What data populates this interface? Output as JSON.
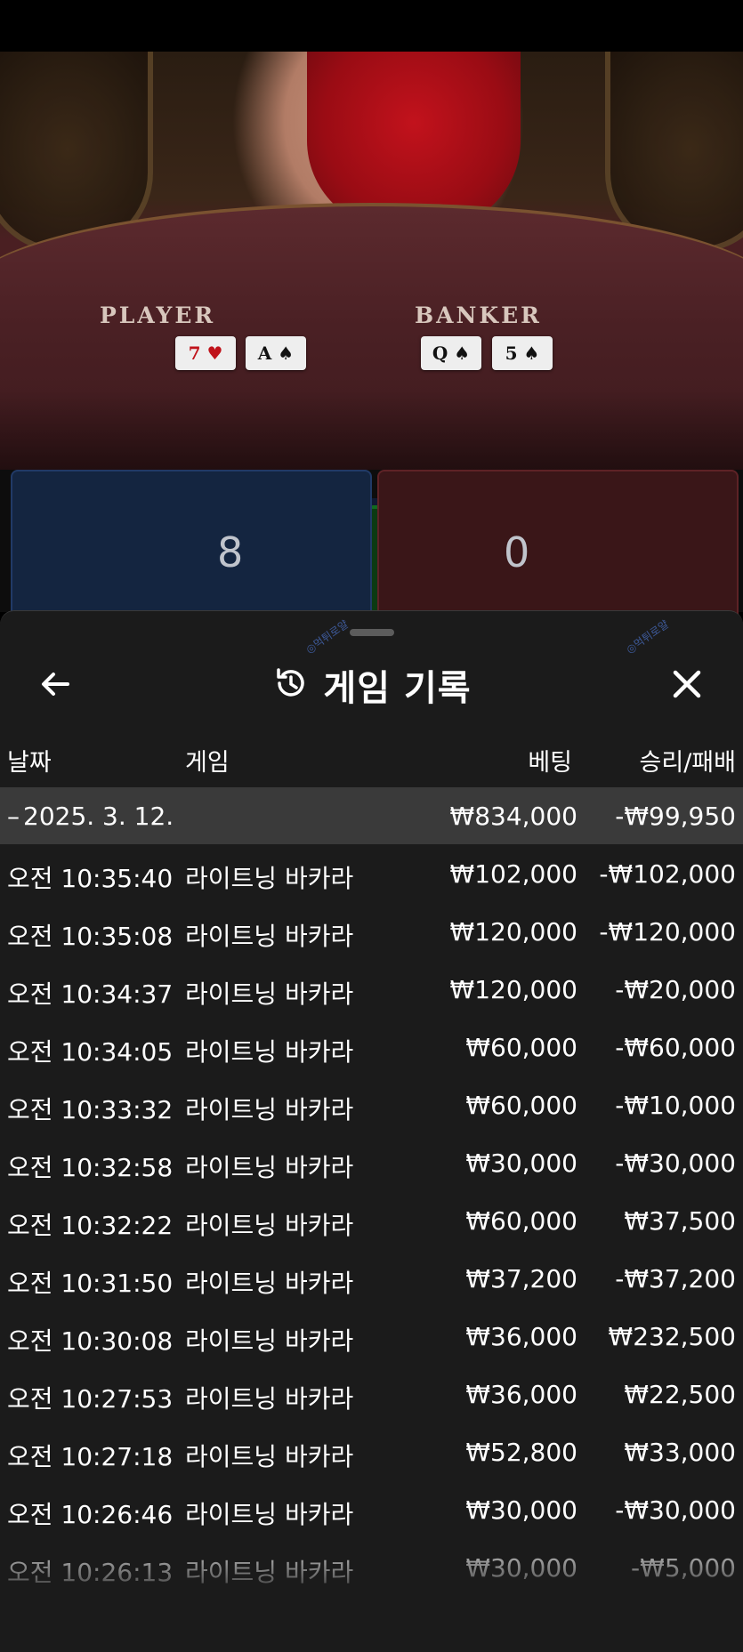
{
  "video": {
    "player_label": "PLAYER",
    "banker_label": "BANKER",
    "player_cards": [
      {
        "rank": "7",
        "suit": "♥",
        "red": true
      },
      {
        "rank": "A",
        "suit": "♠",
        "red": false
      }
    ],
    "banker_cards": [
      {
        "rank": "Q",
        "suit": "♠",
        "red": false
      },
      {
        "rank": "5",
        "suit": "♠",
        "red": false
      }
    ]
  },
  "scoreboard": {
    "player_score": "8",
    "banker_score": "0",
    "player_color": "#142540",
    "banker_color": "#3a1618",
    "tie_color": "#0c3a12"
  },
  "history": {
    "title": "게임 기록",
    "back_icon": "arrow-left-icon",
    "history_icon": "history-clock-icon",
    "close_icon": "close-icon",
    "columns": {
      "date": "날짜",
      "game": "게임",
      "bet": "베팅",
      "result": "승리/패배"
    },
    "date_group": {
      "toggle": "–",
      "date": "2025. 3. 12.",
      "total_bet": "₩834,000",
      "total_result": "-₩99,950"
    },
    "rows": [
      {
        "time": "오전 10:35:40",
        "game": "라이트닝 바카라",
        "bet": "₩102,000",
        "result": "-₩102,000"
      },
      {
        "time": "오전 10:35:08",
        "game": "라이트닝 바카라",
        "bet": "₩120,000",
        "result": "-₩120,000"
      },
      {
        "time": "오전 10:34:37",
        "game": "라이트닝 바카라",
        "bet": "₩120,000",
        "result": "-₩20,000"
      },
      {
        "time": "오전 10:34:05",
        "game": "라이트닝 바카라",
        "bet": "₩60,000",
        "result": "-₩60,000"
      },
      {
        "time": "오전 10:33:32",
        "game": "라이트닝 바카라",
        "bet": "₩60,000",
        "result": "-₩10,000"
      },
      {
        "time": "오전 10:32:58",
        "game": "라이트닝 바카라",
        "bet": "₩30,000",
        "result": "-₩30,000"
      },
      {
        "time": "오전 10:32:22",
        "game": "라이트닝 바카라",
        "bet": "₩60,000",
        "result": "₩37,500"
      },
      {
        "time": "오전 10:31:50",
        "game": "라이트닝 바카라",
        "bet": "₩37,200",
        "result": "-₩37,200"
      },
      {
        "time": "오전 10:30:08",
        "game": "라이트닝 바카라",
        "bet": "₩36,000",
        "result": "₩232,500"
      },
      {
        "time": "오전 10:27:53",
        "game": "라이트닝 바카라",
        "bet": "₩36,000",
        "result": "₩22,500"
      },
      {
        "time": "오전 10:27:18",
        "game": "라이트닝 바카라",
        "bet": "₩52,800",
        "result": "₩33,000"
      },
      {
        "time": "오전 10:26:46",
        "game": "라이트닝 바카라",
        "bet": "₩30,000",
        "result": "-₩30,000"
      },
      {
        "time": "오전 10:26:13",
        "game": "라이트닝 바카라",
        "bet": "₩30,000",
        "result": "-₩5,000"
      }
    ]
  }
}
